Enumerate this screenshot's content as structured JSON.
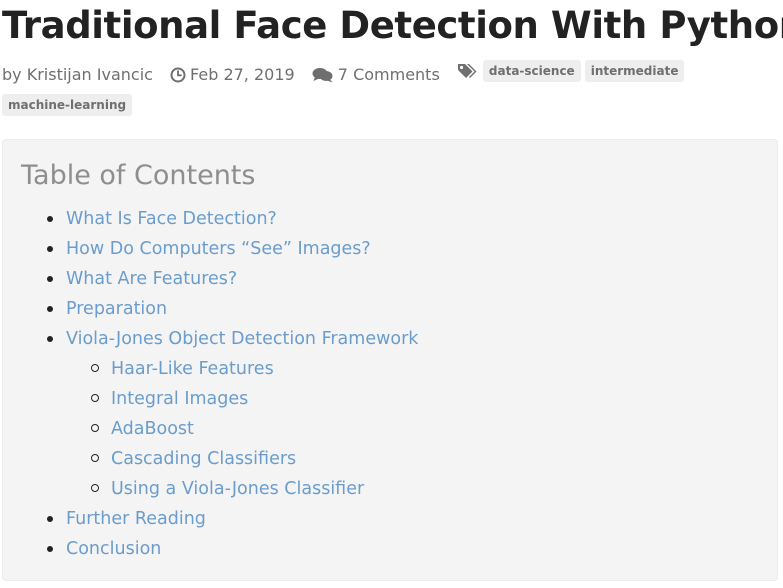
{
  "article": {
    "title": "Traditional Face Detection With Python",
    "author": "by Kristijan Ivancic",
    "date": "Feb 27, 2019",
    "comments": "7 Comments",
    "tags": [
      "data-science",
      "intermediate",
      "machine-learning"
    ]
  },
  "toc": {
    "heading": "Table of Contents",
    "items": [
      {
        "label": "What Is Face Detection?"
      },
      {
        "label": "How Do Computers “See” Images?"
      },
      {
        "label": "What Are Features?"
      },
      {
        "label": "Preparation"
      },
      {
        "label": "Viola-Jones Object Detection Framework",
        "children": [
          {
            "label": "Haar-Like Features"
          },
          {
            "label": "Integral Images"
          },
          {
            "label": "AdaBoost"
          },
          {
            "label": "Cascading Classifiers"
          },
          {
            "label": "Using a Viola-Jones Classifier"
          }
        ]
      },
      {
        "label": "Further Reading"
      },
      {
        "label": "Conclusion"
      }
    ]
  },
  "icons": {
    "date": "clock-icon",
    "comments": "comments-icon",
    "tags": "tags-icon"
  },
  "colors": {
    "link": "#6a9dcd",
    "meta": "#6f6f6f",
    "toc_background": "#f4f4f4",
    "tag_background": "#eeeeee"
  }
}
